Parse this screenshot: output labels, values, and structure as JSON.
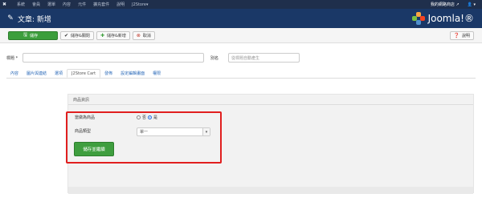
{
  "topnav": {
    "items": [
      "系統",
      "會員",
      "選單",
      "內容",
      "元件",
      "擴充套件",
      "說明"
    ],
    "active": "J2Store",
    "active_caret": "▾",
    "site_link": "我的網路商店",
    "site_icon": "external-link-icon",
    "user_icon": "user-icon"
  },
  "header": {
    "title": "文章: 新增",
    "brand": "Joomla!®",
    "brand_colors": [
      "#f9a541",
      "#f44321",
      "#5091cd",
      "#7ac143"
    ]
  },
  "toolbar": {
    "save": "儲存",
    "save_close": "儲存&關閉",
    "save_new": "儲存&新增",
    "cancel": "取消",
    "help": "說明"
  },
  "form": {
    "title_label": "標題 *",
    "alias_label": "別名",
    "alias_placeholder": "從標題自動產生"
  },
  "tabs": [
    "內容",
    "圖片與連結",
    "選項",
    "J2Store Cart",
    "發佈",
    "設定編輯畫面",
    "權限"
  ],
  "active_tab": "J2Store Cart",
  "product_panel": {
    "heading": "商品資訊",
    "treat_as_product_label": "當做為商品",
    "radio_no": "否",
    "radio_yes": "是",
    "selected": "是",
    "product_type_label": "商品類型",
    "product_type_value": "單一",
    "continue_button": "儲存並繼續"
  },
  "colors": {
    "nav_bg": "#1f2f4c",
    "header_bg": "#1a3867",
    "save_green": "#3c9e3c",
    "highlight_red": "#e11f1f"
  }
}
